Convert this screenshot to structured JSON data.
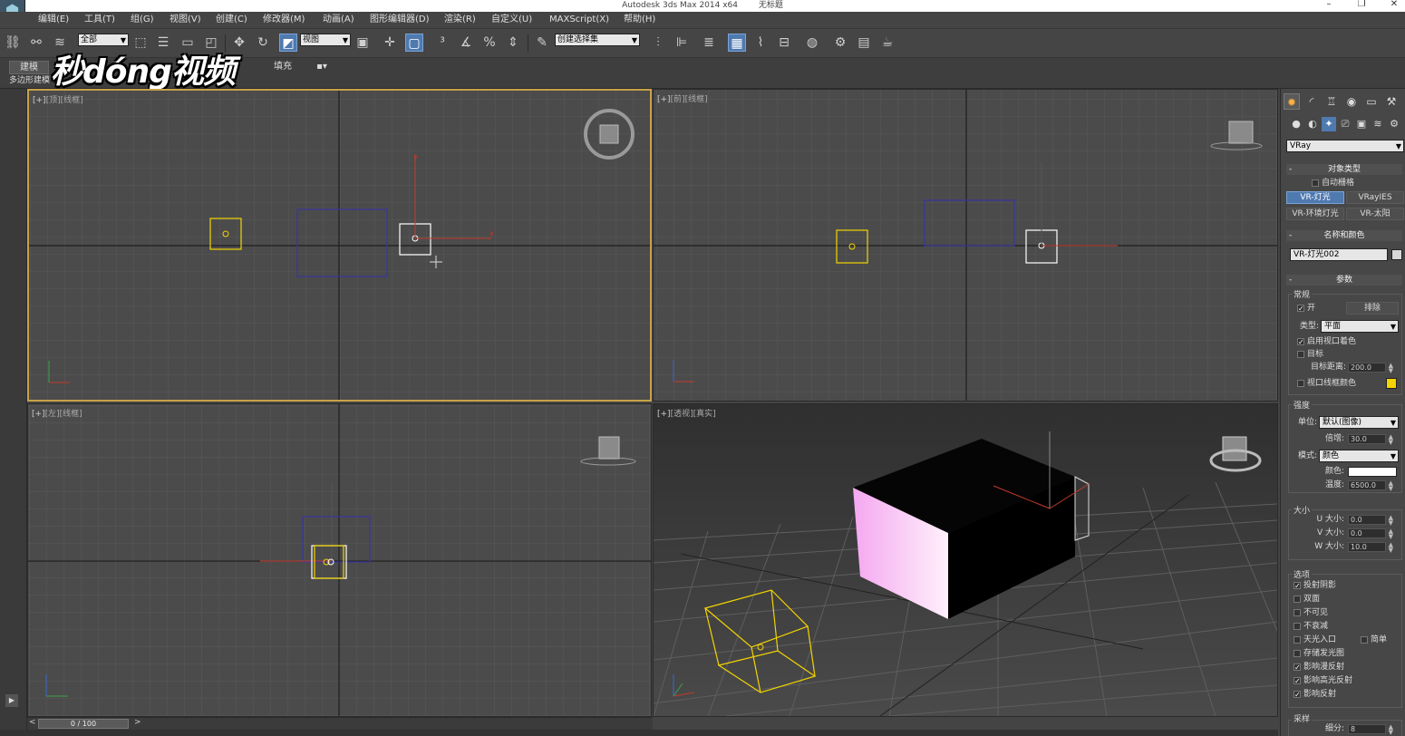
{
  "titlebar": {
    "app_title": "Autodesk 3ds Max  2014 x64",
    "doc_title": "无标题",
    "minimize": "–",
    "maximize": "❐",
    "close": "✕"
  },
  "menu": [
    "编辑(E)",
    "工具(T)",
    "组(G)",
    "视图(V)",
    "创建(C)",
    "修改器(M)",
    "动画(A)",
    "图形编辑器(D)",
    "渲染(R)",
    "自定义(U)",
    "MAXScript(X)",
    "帮助(H)"
  ],
  "toolbar": {
    "selection_filter": "全部",
    "reference_coord": "视图",
    "named_selection": "创建选择集"
  },
  "ribbon": {
    "tab_modeling": "建模",
    "tab_populate": "填充",
    "sub_label": "多边形建模"
  },
  "watermark": "秒dóng视频",
  "viewports": {
    "top": {
      "label_plus": "[+]",
      "label_view": "[顶]",
      "label_shading": "[线框]"
    },
    "front": {
      "label_plus": "[+]",
      "label_view": "[前]",
      "label_shading": "[线框]"
    },
    "left": {
      "label_plus": "[+]",
      "label_view": "[左]",
      "label_shading": "[线框]"
    },
    "persp": {
      "label_plus": "[+]",
      "label_view": "[透视]",
      "label_shading": "[真实]"
    }
  },
  "timeline": {
    "frame": "0 / 100",
    "prev": "<",
    "next": ">"
  },
  "cmdpanel": {
    "renderer_dropdown": "VRay",
    "object_type": {
      "title": "对象类型",
      "auto_grid": "自动栅格",
      "buttons": [
        "VR-灯光",
        "VRayIES",
        "VR-环境灯光",
        "VR-太阳"
      ]
    },
    "name_color": {
      "title": "名称和颜色",
      "name": "VR-灯光002",
      "color": "#d8d8d8"
    },
    "params": {
      "title": "参数",
      "general_group": "常规",
      "on": "开",
      "exclude": "排除",
      "type_label": "类型:",
      "type_value": "平面",
      "enable_viewport_shading": "启用视口着色",
      "targeted": "目标",
      "target_distance_label": "目标距离:",
      "target_distance": "200.0",
      "viewport_wire_color": "视口线框颜色",
      "wire_swatch": "#f3d400"
    },
    "intensity": {
      "group": "强度",
      "units_label": "单位:",
      "units_value": "默认(图像)",
      "multiplier_label": "倍增:",
      "multiplier": "30.0",
      "mode_label": "模式:",
      "mode_value": "颜色",
      "color_label": "颜色:",
      "color": "#ffffff",
      "temp_label": "温度:",
      "temp": "6500.0"
    },
    "size": {
      "group": "大小",
      "u_label": "U 大小:",
      "u": "0.0",
      "v_label": "V 大小:",
      "v": "0.0",
      "w_label": "W 大小:",
      "w": "10.0"
    },
    "options": {
      "group": "选项",
      "items": [
        {
          "label": "投射阴影",
          "checked": "✓"
        },
        {
          "label": "双面",
          "checked": ""
        },
        {
          "label": "不可见",
          "checked": ""
        },
        {
          "label": "不衰减",
          "checked": ""
        },
        {
          "label": "天光入口",
          "checked": ""
        },
        {
          "label": "存储发光图",
          "checked": ""
        },
        {
          "label": "影响漫反射",
          "checked": "✓"
        },
        {
          "label": "影响高光反射",
          "checked": "✓"
        },
        {
          "label": "影响反射",
          "checked": "✓"
        }
      ],
      "simple": "简单"
    },
    "sampling": {
      "group": "采样",
      "subdivs_label": "细分:",
      "subdivs": "8"
    }
  },
  "colors": {
    "active_border": "#c8a24a",
    "selection_yellow": "#f3d400",
    "accent_blue": "#4f7ab0"
  }
}
